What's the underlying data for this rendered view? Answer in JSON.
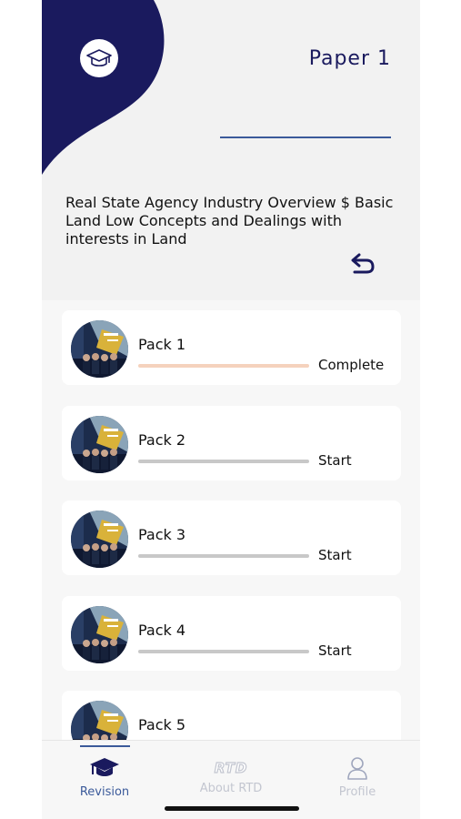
{
  "header": {
    "title": "Paper 1",
    "description": "Real State Agency Industry Overview $ Basic Land Low Concepts and Dealings with interests in Land",
    "logo_icon": "graduation-cap-icon",
    "back_icon": "undo-arrow-icon"
  },
  "colors": {
    "navy": "#1a1a5e",
    "accent_line": "#3b5a9a",
    "complete_bar": "#f5d2bd",
    "idle_bar": "#c8c8c8",
    "tab_active": "#3b5a9a",
    "tab_inactive": "#c3c6d0"
  },
  "packs": [
    {
      "name": "Pack 1",
      "status": "Complete",
      "progress": 1.0
    },
    {
      "name": "Pack 2",
      "status": "Start",
      "progress": 0
    },
    {
      "name": "Pack 3",
      "status": "Start",
      "progress": 0
    },
    {
      "name": "Pack 4",
      "status": "Start",
      "progress": 0
    },
    {
      "name": "Pack 5",
      "status": "",
      "progress": 0
    }
  ],
  "tabs": [
    {
      "label": "Revision",
      "icon": "graduation-cap-icon",
      "active": true
    },
    {
      "label": "About RTD",
      "icon": "rtd-logo-icon",
      "active": false
    },
    {
      "label": "Profile",
      "icon": "user-icon",
      "active": false
    }
  ],
  "tab_logo_text": "RTD"
}
